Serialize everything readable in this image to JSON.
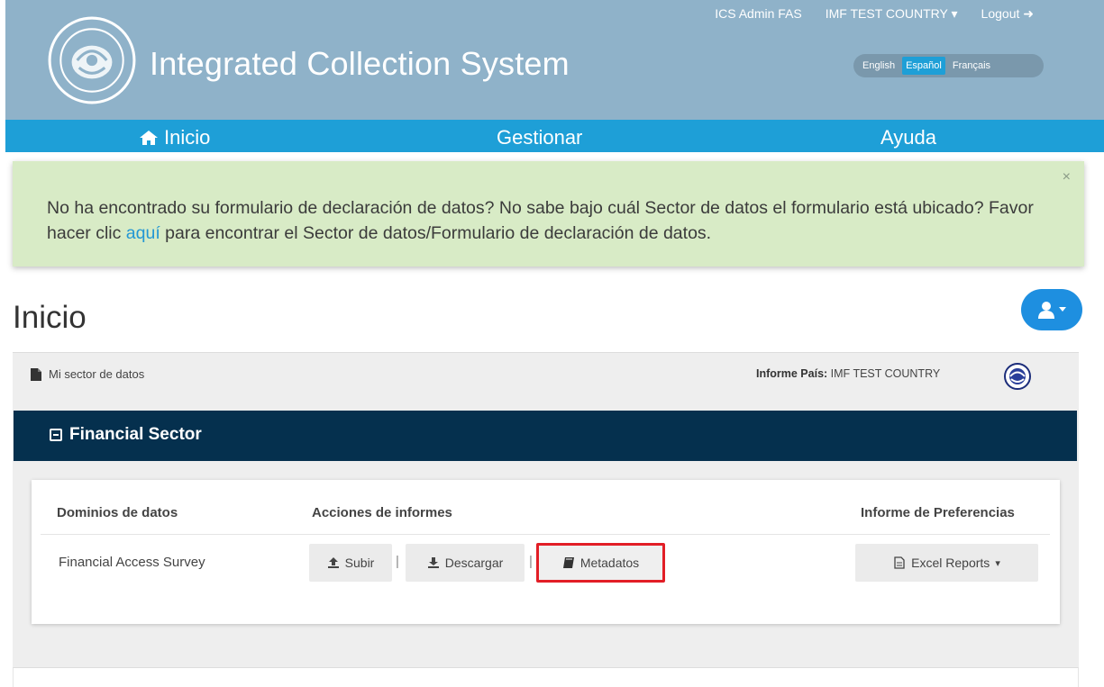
{
  "header": {
    "title": "Integrated Collection System",
    "user": "ICS Admin FAS",
    "country": "IMF TEST COUNTRY",
    "logout": "Logout",
    "languages": [
      "English",
      "Español",
      "Français"
    ],
    "active_language": "Español"
  },
  "nav": {
    "home": "Inicio",
    "manage": "Gestionar",
    "help": "Ayuda"
  },
  "alert": {
    "text_before": "No ha encontrado su formulario de declaración de datos? No sabe bajo cuál Sector de datos el formulario está ubicado? Favor hacer clic ",
    "link": "aquí",
    "text_after": " para encontrar el Sector de datos/Formulario de declaración de datos.",
    "close": "×"
  },
  "page": {
    "title": "Inicio"
  },
  "panel": {
    "my_sector": "Mi sector de datos",
    "report_label": "Informe País:",
    "report_value": "IMF TEST COUNTRY",
    "sector_title": "Financial Sector",
    "columns": [
      "Dominios de datos",
      "Acciones de informes",
      "Informe de Preferencias"
    ],
    "row": {
      "domain": "Financial Access Survey",
      "upload": "Subir",
      "download": "Descargar",
      "metadata": "Metadatos",
      "excel": "Excel Reports",
      "separator": "|"
    }
  },
  "colors": {
    "header": "#8fb2c9",
    "nav": "#1e9fd7",
    "alert": "#d8ebc6",
    "sector_bar": "#05304e",
    "highlight": "#e21e26"
  }
}
